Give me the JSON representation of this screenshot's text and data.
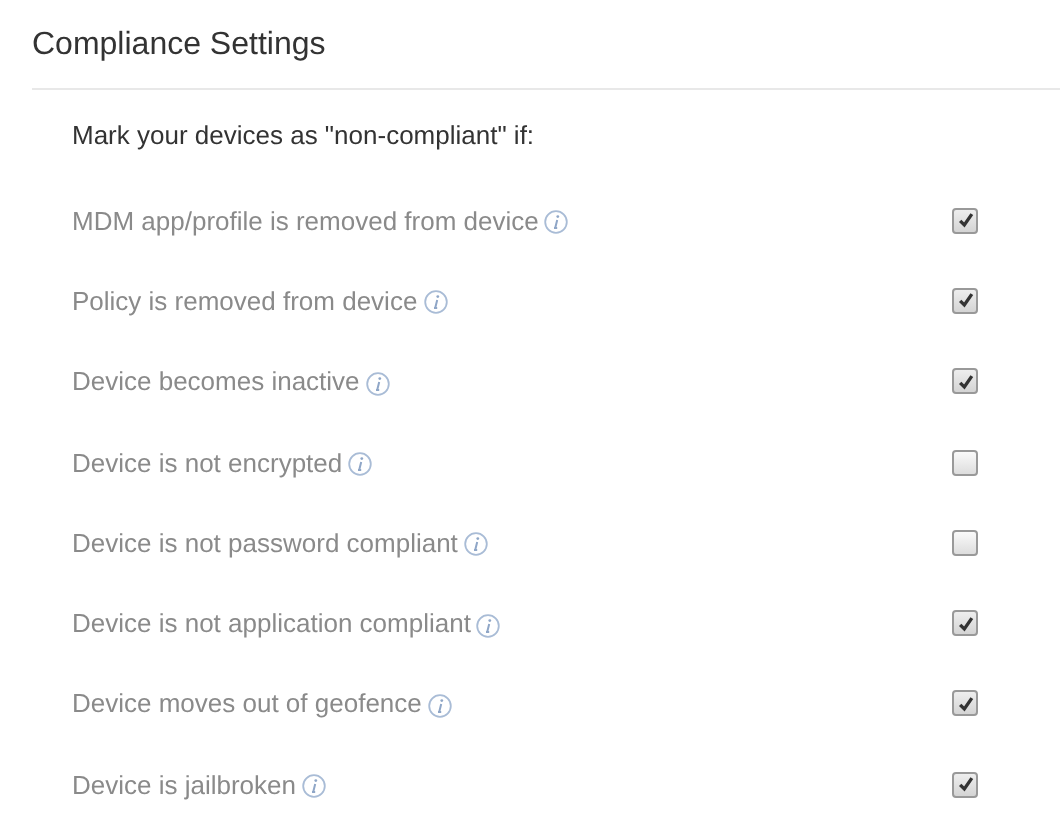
{
  "title": "Compliance Settings",
  "intro": "Mark your devices as \"non-compliant\" if:",
  "options": [
    {
      "label": "MDM app/profile is removed from device",
      "checked": true
    },
    {
      "label": "Policy is removed from device",
      "checked": true
    },
    {
      "label": "Device becomes inactive",
      "checked": true
    },
    {
      "label": "Device is not encrypted",
      "checked": false
    },
    {
      "label": "Device is not password compliant",
      "checked": false
    },
    {
      "label": "Device is not application compliant",
      "checked": true
    },
    {
      "label": "Device moves out of geofence",
      "checked": true
    },
    {
      "label": "Device is jailbroken",
      "checked": true
    }
  ]
}
